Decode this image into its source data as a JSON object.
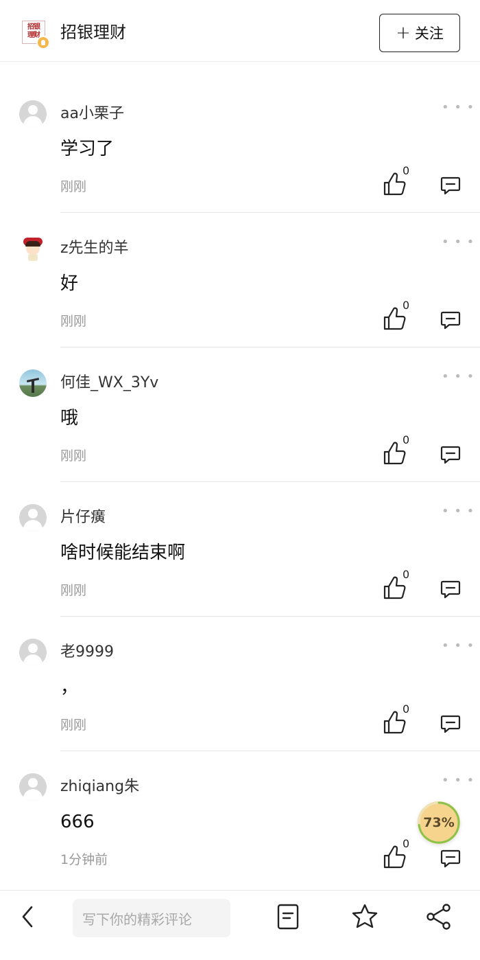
{
  "header": {
    "logo_text": "招银理财",
    "title": "招银理财",
    "follow_label": "关注"
  },
  "comments": [
    {
      "username": "aa小栗子",
      "content": "学习了",
      "time": "刚刚",
      "likes": "0",
      "avatar": "default-avatar"
    },
    {
      "username": "z先生的羊",
      "content": "好",
      "time": "刚刚",
      "likes": "0",
      "avatar": "cartoon-girl-avatar"
    },
    {
      "username": "何佳_WX_3Yv",
      "content": "哦",
      "time": "刚刚",
      "likes": "0",
      "avatar": "sky-photo-avatar"
    },
    {
      "username": "片仔癀",
      "content": "啥时候能结束啊",
      "time": "刚刚",
      "likes": "0",
      "avatar": "default-avatar"
    },
    {
      "username": "老9999",
      "content": "，",
      "time": "刚刚",
      "likes": "0",
      "avatar": "default-avatar"
    },
    {
      "username": "zhiqiang朱",
      "content": "666",
      "time": "1分钟前",
      "likes": "0",
      "avatar": "default-avatar"
    }
  ],
  "progress": {
    "label": "73%",
    "value": 0.73
  },
  "bottom_bar": {
    "input_placeholder": "写下你的精彩评论",
    "icons": [
      "back-icon",
      "document-icon",
      "star-icon",
      "share-icon"
    ]
  },
  "colors": {
    "brand_red": "#b1282a",
    "progress_fill": "#f6d48d",
    "progress_ring": "#8bc34a"
  }
}
